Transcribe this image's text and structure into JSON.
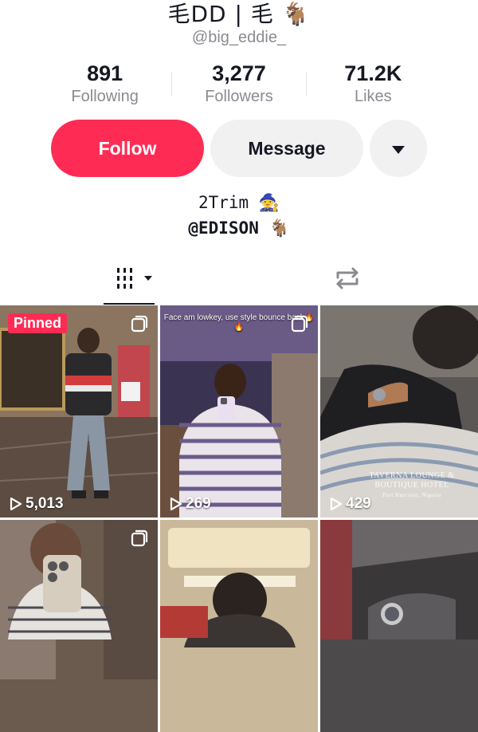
{
  "profile": {
    "display_name": "毛DD | 毛 🐐",
    "username": "@big_eddie_"
  },
  "stats": [
    {
      "value": "891",
      "label": "Following"
    },
    {
      "value": "3,277",
      "label": "Followers"
    },
    {
      "value": "71.2K",
      "label": "Likes"
    }
  ],
  "actions": {
    "follow_label": "Follow",
    "message_label": "Message"
  },
  "bio": {
    "line1": "2Trim 🧙",
    "line2": "@EDISON 🐐"
  },
  "tabs": {
    "videos_icon": "grid-icon",
    "reposts_icon": "repost-icon"
  },
  "videos": [
    {
      "views": "5,013",
      "badge": "Pinned",
      "multi": true
    },
    {
      "views": "269",
      "caption": "Face am lowkey, use style bounce back🔥🔥",
      "multi": true
    },
    {
      "views": "429",
      "sign_line1": "TAVERNA LOUNGE &",
      "sign_line2": "BOUTIQUE HOTEL",
      "sign_line3": "Port Harcourt, Nigeria"
    },
    {
      "multi": true
    },
    {},
    {}
  ],
  "colors": {
    "accent": "#fe2c55",
    "secondary_bg": "#f1f1f2",
    "muted_text": "#8a8b91"
  }
}
